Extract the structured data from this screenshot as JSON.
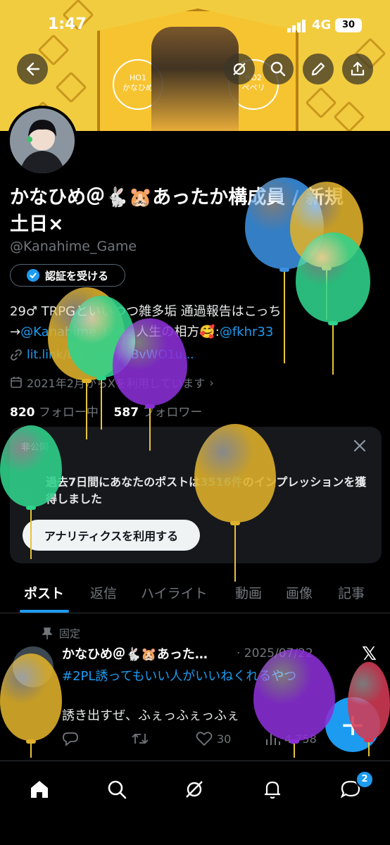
{
  "status_bar": {
    "time": "1:47",
    "network": "4G",
    "battery": "30"
  },
  "banner": {
    "sign_left": "HO1\nかなひめ",
    "sign_right": "HO2\nペペリ"
  },
  "profile": {
    "name_line1": "かなひめ＠🐇🐹あったか構成員 / 新規",
    "name_line2": "土日×",
    "handle": "@Kanahime_Game",
    "verify_label": "認証を受ける",
    "bio_line1": "29♂ TRPGといいつつ雑多垢 通過報告はこっち",
    "bio_line2_prefix": "→",
    "bio_line2_link": "@Kanahime_Logs",
    "bio_line2_mid": " 人生の相方🥰:",
    "bio_line2_link2": "@fkhr33",
    "link": "lit.link/BS_fieldeNBvWO1u...",
    "joined": "2021年2月からXを利用しています",
    "following_count": "820",
    "following_label": "フォロー中",
    "followers_count": "587",
    "followers_label": "フォロワー"
  },
  "analytics": {
    "private_label": "非公開",
    "impressions_pre": "過去7日間にあなたのポストは",
    "impressions_count": "3516件",
    "impressions_post": "のインプレッションを獲得しました",
    "button": "アナリティクスを利用する"
  },
  "tabs": [
    "ポスト",
    "返信",
    "ハイライト",
    "動画",
    "画像",
    "記事"
  ],
  "post": {
    "pinned_label": "固定",
    "author": "かなひめ＠🐇🐹あった…",
    "date": "· 2025/07/22",
    "x_logo": "𝕏",
    "hashtag": "#2PL誘ってもいい人がいいねくれるやつ",
    "text": "誘き出すぜ、ふぇっふぇっふぇ",
    "likes": "30",
    "views": "4,758"
  },
  "nav": {
    "messages_badge": "2"
  },
  "icons": [
    "back-icon",
    "grok-icon",
    "search-icon",
    "edit-icon",
    "share-icon",
    "verified-badge-icon",
    "link-icon",
    "calendar-icon",
    "close-icon",
    "pin-icon",
    "reply-icon",
    "repost-icon",
    "like-icon",
    "views-icon",
    "plus-icon",
    "home-icon",
    "explore-icon",
    "grok-nav-icon",
    "notifications-icon",
    "messages-icon"
  ],
  "colors": {
    "accent": "#1d9bf0",
    "background": "#000000",
    "banner": "#f2cc3f"
  }
}
